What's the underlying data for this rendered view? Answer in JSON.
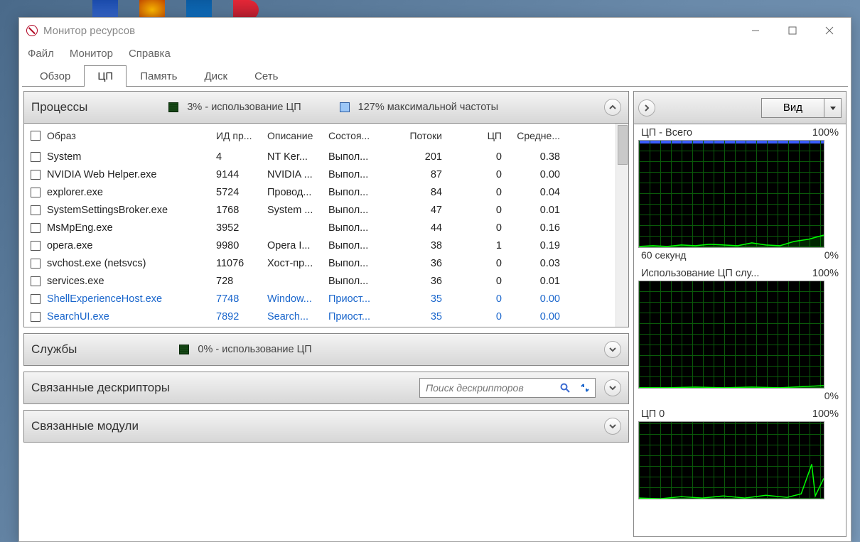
{
  "window": {
    "title": "Монитор ресурсов"
  },
  "menu": {
    "file": "Файл",
    "monitor": "Монитор",
    "help": "Справка"
  },
  "tabs": {
    "overview": "Обзор",
    "cpu": "ЦП",
    "memory": "Память",
    "disk": "Диск",
    "network": "Сеть"
  },
  "processes": {
    "title": "Процессы",
    "cpu_text": "3% - использование ЦП",
    "freq_text": "127% максимальной частоты",
    "cols": {
      "image": "Образ",
      "pid": "ИД пр...",
      "desc": "Описание",
      "state": "Состоя...",
      "threads": "Потоки",
      "cpu": "ЦП",
      "avg": "Средне..."
    },
    "rows": [
      {
        "image": "System",
        "pid": "4",
        "desc": "NT Ker...",
        "state": "Выпол...",
        "threads": "201",
        "cpu": "0",
        "avg": "0.38",
        "blue": false
      },
      {
        "image": "NVIDIA Web Helper.exe",
        "pid": "9144",
        "desc": "NVIDIA ...",
        "state": "Выпол...",
        "threads": "87",
        "cpu": "0",
        "avg": "0.00",
        "blue": false
      },
      {
        "image": "explorer.exe",
        "pid": "5724",
        "desc": "Провод...",
        "state": "Выпол...",
        "threads": "84",
        "cpu": "0",
        "avg": "0.04",
        "blue": false
      },
      {
        "image": "SystemSettingsBroker.exe",
        "pid": "1768",
        "desc": "System ...",
        "state": "Выпол...",
        "threads": "47",
        "cpu": "0",
        "avg": "0.01",
        "blue": false
      },
      {
        "image": "MsMpEng.exe",
        "pid": "3952",
        "desc": "",
        "state": "Выпол...",
        "threads": "44",
        "cpu": "0",
        "avg": "0.16",
        "blue": false
      },
      {
        "image": "opera.exe",
        "pid": "9980",
        "desc": "Opera I...",
        "state": "Выпол...",
        "threads": "38",
        "cpu": "1",
        "avg": "0.19",
        "blue": false
      },
      {
        "image": "svchost.exe (netsvcs)",
        "pid": "11076",
        "desc": "Хост-пр...",
        "state": "Выпол...",
        "threads": "36",
        "cpu": "0",
        "avg": "0.03",
        "blue": false
      },
      {
        "image": "services.exe",
        "pid": "728",
        "desc": "",
        "state": "Выпол...",
        "threads": "36",
        "cpu": "0",
        "avg": "0.01",
        "blue": false
      },
      {
        "image": "ShellExperienceHost.exe",
        "pid": "7748",
        "desc": "Window...",
        "state": "Приост...",
        "threads": "35",
        "cpu": "0",
        "avg": "0.00",
        "blue": true
      },
      {
        "image": "SearchUI.exe",
        "pid": "7892",
        "desc": "Search...",
        "state": "Приост...",
        "threads": "35",
        "cpu": "0",
        "avg": "0.00",
        "blue": true
      }
    ]
  },
  "services": {
    "title": "Службы",
    "cpu_text": "0% - использование ЦП"
  },
  "handles": {
    "title": "Связанные дескрипторы",
    "search_placeholder": "Поиск дескрипторов"
  },
  "modules": {
    "title": "Связанные модули"
  },
  "rightpane": {
    "view_label": "Вид",
    "charts": {
      "total": {
        "label": "ЦП - Всего",
        "max": "100%",
        "xlabel": "60 секунд",
        "xmax": "0%"
      },
      "svc": {
        "label": "Использование ЦП слу...",
        "max": "100%",
        "xmax": "0%"
      },
      "cpu0": {
        "label": "ЦП 0",
        "max": "100%"
      }
    }
  },
  "chart_data": [
    {
      "type": "line",
      "title": "ЦП - Всего",
      "ylabel": "%",
      "ylim": [
        0,
        100
      ],
      "xlabel": "60 секунд",
      "x": [
        0,
        5,
        10,
        15,
        20,
        25,
        30,
        35,
        40,
        45,
        50,
        55,
        60
      ],
      "values": [
        3,
        2,
        3,
        4,
        3,
        5,
        4,
        3,
        6,
        4,
        3,
        8,
        12
      ]
    },
    {
      "type": "line",
      "title": "Использование ЦП службами",
      "ylabel": "%",
      "ylim": [
        0,
        100
      ],
      "x": [
        0,
        5,
        10,
        15,
        20,
        25,
        30,
        35,
        40,
        45,
        50,
        55,
        60
      ],
      "values": [
        0,
        0,
        0,
        1,
        0,
        0,
        1,
        0,
        0,
        1,
        0,
        1,
        2
      ]
    },
    {
      "type": "line",
      "title": "ЦП 0",
      "ylabel": "%",
      "ylim": [
        0,
        100
      ],
      "x": [
        0,
        5,
        10,
        15,
        20,
        25,
        30,
        35,
        40,
        45,
        50,
        55,
        60
      ],
      "values": [
        2,
        1,
        3,
        2,
        4,
        2,
        3,
        5,
        3,
        2,
        6,
        4,
        30
      ]
    }
  ]
}
